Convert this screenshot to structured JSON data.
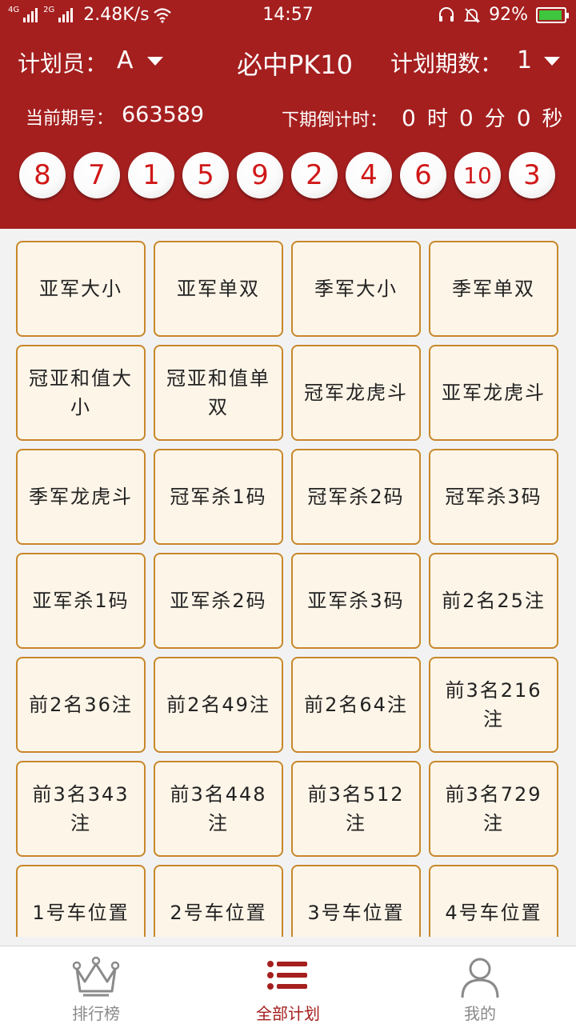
{
  "status_bar": {
    "network_left": "4G",
    "network_right": "2G",
    "speed": "2.48K/s",
    "time": "14:57",
    "battery": "92%",
    "battery_level": 0.92,
    "icons": [
      "signal-icon",
      "wifi-icon",
      "headset-icon",
      "mute-bell-icon",
      "battery-icon"
    ]
  },
  "header": {
    "planner_label": "计划员：",
    "planner_value": "A",
    "title": "必中PK10",
    "period_label": "计划期数：",
    "period_value": "1",
    "issue_label": "当前期号：",
    "issue_value": "663589",
    "countdown_label": "下期倒计时：",
    "countdown": {
      "hours": "0",
      "hours_unit": "时",
      "minutes": "0",
      "minutes_unit": "分",
      "seconds": "0",
      "seconds_unit": "秒"
    },
    "colors": {
      "header_bg": "#a51f1f",
      "ball_text": "#d01818"
    }
  },
  "balls": [
    "8",
    "7",
    "1",
    "5",
    "9",
    "2",
    "4",
    "6",
    "10",
    "3"
  ],
  "plans": [
    "亚军大小",
    "亚军单双",
    "季军大小",
    "季军单双",
    "冠亚和值大小",
    "冠亚和值单双",
    "冠军龙虎斗",
    "亚军龙虎斗",
    "季军龙虎斗",
    "冠军杀1码",
    "冠军杀2码",
    "冠军杀3码",
    "亚军杀1码",
    "亚军杀2码",
    "亚军杀3码",
    "前2名25注",
    "前2名36注",
    "前2名49注",
    "前2名64注",
    "前3名216注",
    "前3名343注",
    "前3名448注",
    "前3名512注",
    "前3名729注",
    "1号车位置",
    "2号车位置",
    "3号车位置",
    "4号车位置"
  ],
  "bottom_nav": {
    "items": [
      {
        "label": "排行榜",
        "icon": "crown-icon",
        "active": false
      },
      {
        "label": "全部计划",
        "icon": "list-icon",
        "active": true
      },
      {
        "label": "我的",
        "icon": "user-icon",
        "active": false
      }
    ],
    "active_color": "#a51f1f",
    "inactive_color": "#8a8a8a"
  }
}
